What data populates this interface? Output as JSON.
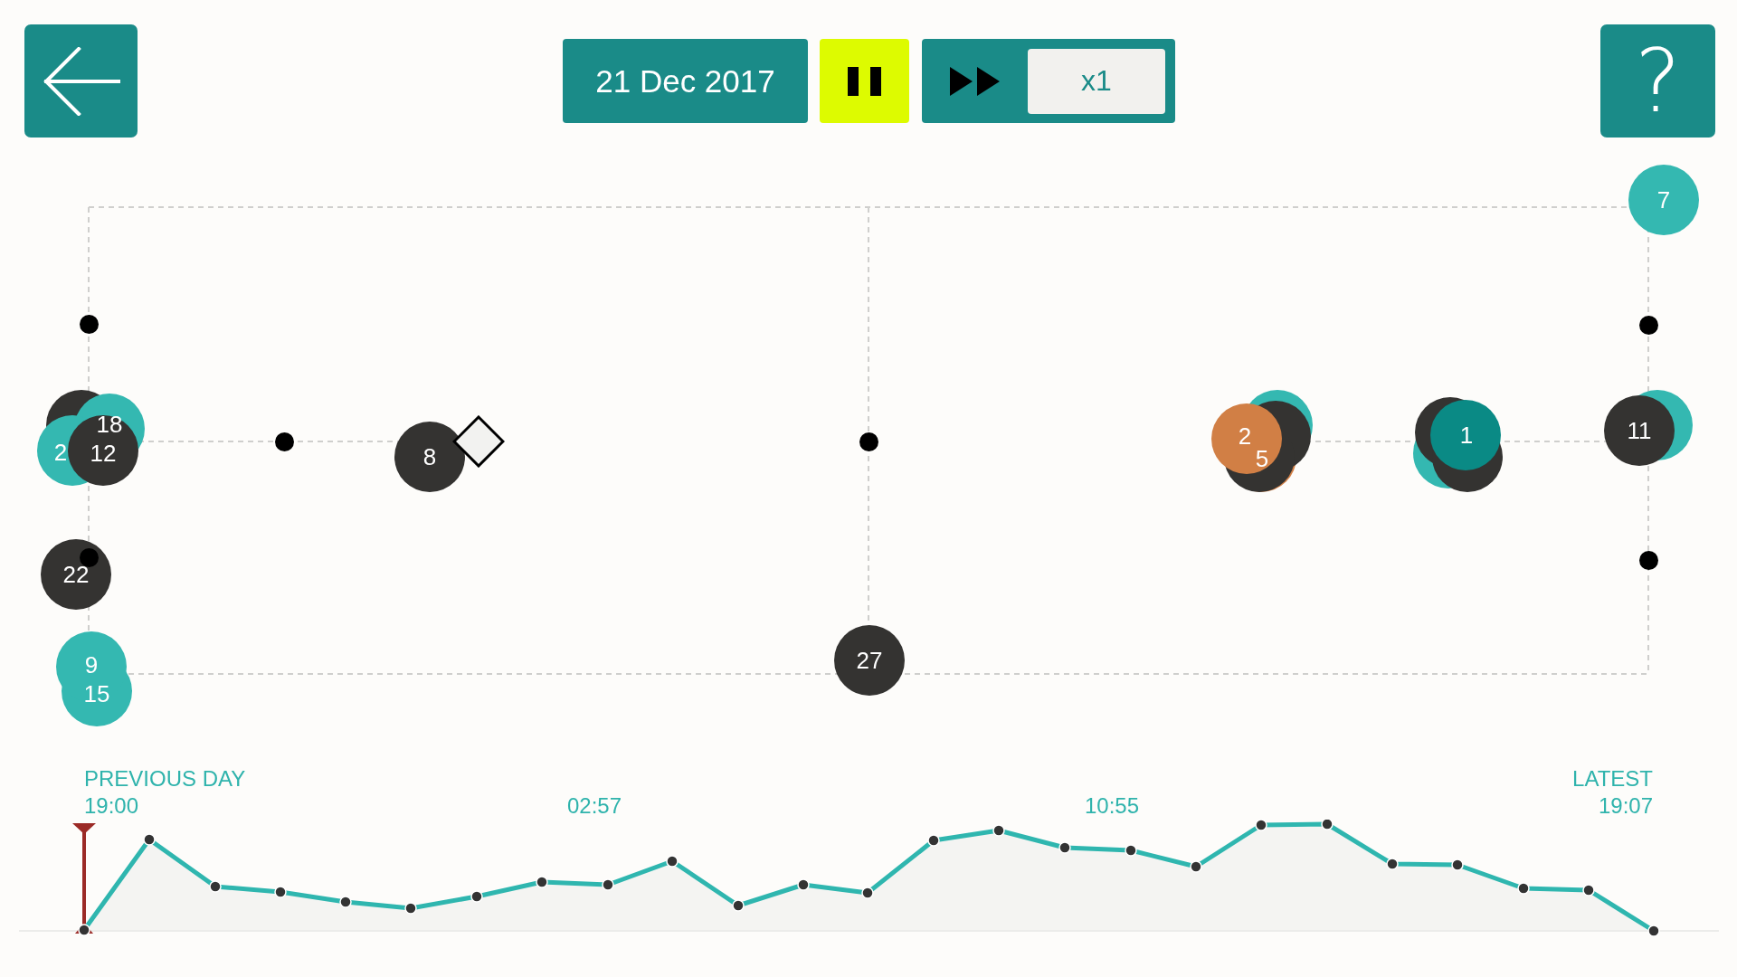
{
  "toolbar": {
    "date": "21 Dec 2017",
    "playing": true,
    "speed": "x1",
    "help": "?"
  },
  "map": {
    "markers": [
      {
        "kind": "node",
        "label": "7",
        "color": "#34b8b1"
      },
      {
        "kind": "cluster",
        "nodes": [
          {
            "color": "#343331"
          },
          {
            "label": "18",
            "color": "#34b8b1"
          },
          {
            "label": "2",
            "color": "#34b8b1"
          },
          {
            "label": "12",
            "color": "#343331"
          }
        ]
      },
      {
        "kind": "node",
        "label": "8",
        "color": "#343331"
      },
      {
        "kind": "cluster",
        "nodes": [
          {
            "color": "#34b8b1"
          },
          {
            "color": "#343331"
          },
          {
            "label": "2",
            "color": "#d17f45"
          },
          {
            "label": "5",
            "color": "#d17f45"
          },
          {
            "color": "#343331"
          }
        ]
      },
      {
        "kind": "cluster",
        "nodes": [
          {
            "color": "#343331"
          },
          {
            "label": "1",
            "color": "#0a8a85"
          },
          {
            "color": "#34b8b1"
          },
          {
            "color": "#343331"
          }
        ]
      },
      {
        "kind": "cluster",
        "nodes": [
          {
            "color": "#34b8b1"
          },
          {
            "label": "11",
            "color": "#343331"
          }
        ]
      },
      {
        "kind": "node",
        "label": "22",
        "color": "#343331"
      },
      {
        "kind": "cluster",
        "nodes": [
          {
            "label": "9",
            "color": "#34b8b1"
          },
          {
            "label": "15",
            "color": "#34b8b1"
          }
        ]
      },
      {
        "kind": "node",
        "label": "27",
        "color": "#343331"
      }
    ]
  },
  "timeline": {
    "start_label": "PREVIOUS DAY",
    "start_time": "19:00",
    "ticks": [
      "02:57",
      "10:55"
    ],
    "end_label": "LATEST",
    "end_time": "19:07",
    "playhead": {
      "level": 0
    }
  }
}
